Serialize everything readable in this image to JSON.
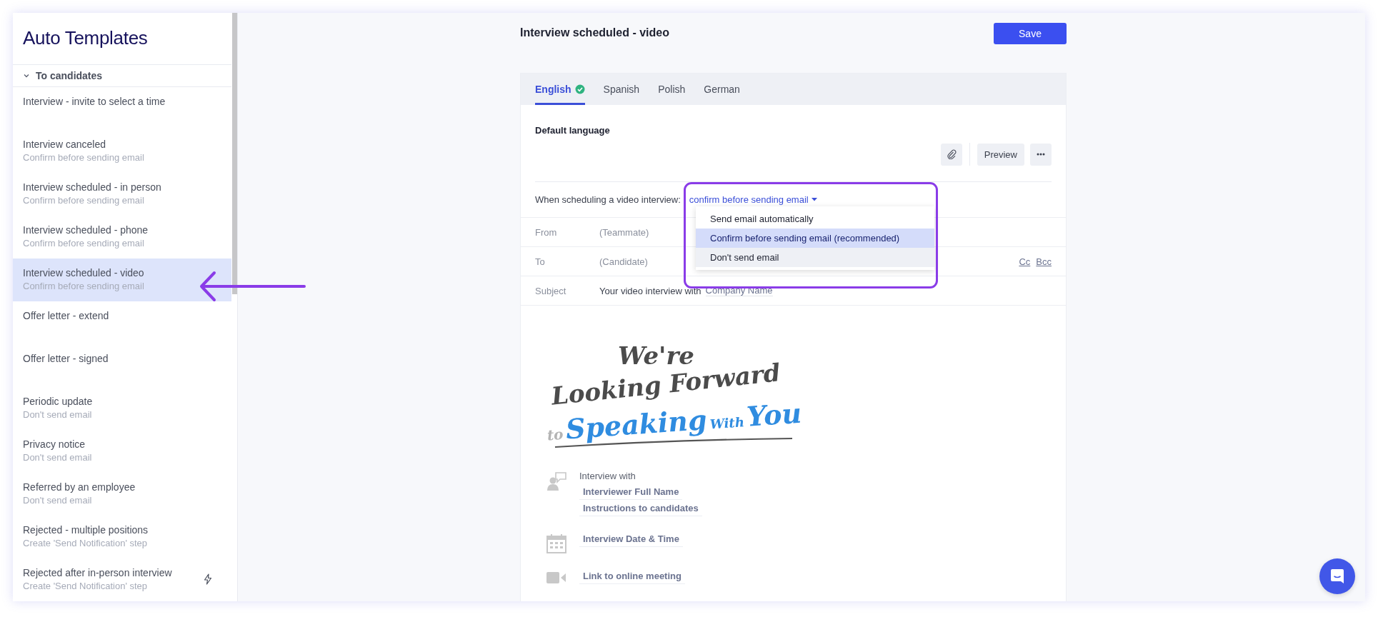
{
  "sidebar": {
    "title": "Auto Templates",
    "group": {
      "label": "To candidates",
      "expanded": true
    },
    "items": [
      {
        "title": "Interview - invite to select a time",
        "selected": false,
        "automated": false
      },
      {
        "title": "Interview canceled",
        "subtitle": "Confirm before sending email",
        "selected": false,
        "automated": false
      },
      {
        "title": "Interview scheduled - in person",
        "subtitle": "Confirm before sending email",
        "selected": false,
        "automated": false
      },
      {
        "title": "Interview scheduled - phone",
        "subtitle": "Confirm before sending email",
        "selected": false,
        "automated": false
      },
      {
        "title": "Interview scheduled - video",
        "subtitle": "Confirm before sending email",
        "selected": true,
        "automated": false
      },
      {
        "title": "Offer letter - extend",
        "selected": false,
        "automated": false
      },
      {
        "title": "Offer letter - signed",
        "selected": false,
        "automated": false
      },
      {
        "title": "Periodic update",
        "subtitle": "Don't send email",
        "selected": false,
        "automated": false
      },
      {
        "title": "Privacy notice",
        "subtitle": "Don't send email",
        "selected": false,
        "automated": false
      },
      {
        "title": "Referred by an employee",
        "subtitle": "Don't send email",
        "selected": false,
        "automated": false
      },
      {
        "title": "Rejected - multiple positions",
        "subtitle": "Create 'Send Notification' step",
        "selected": false,
        "automated": false
      },
      {
        "title": "Rejected after in-person interview",
        "subtitle": "Create 'Send Notification' step",
        "selected": false,
        "automated": true
      }
    ]
  },
  "header": {
    "title": "Interview scheduled - video",
    "save": "Save"
  },
  "tabs": [
    {
      "label": "English",
      "selected": true,
      "verified": true
    },
    {
      "label": "Spanish",
      "selected": false,
      "verified": false
    },
    {
      "label": "Polish",
      "selected": false,
      "verified": false
    },
    {
      "label": "German",
      "selected": false,
      "verified": false
    }
  ],
  "section_label": "Default language",
  "toolbar": {
    "preview": "Preview"
  },
  "rule": {
    "text": "When scheduling a video interview:",
    "value": "confirm before sending email"
  },
  "dropdown": [
    {
      "label": "Send email automatically",
      "selected": false,
      "hovered": false
    },
    {
      "label": "Confirm before sending email (recommended)",
      "selected": true,
      "hovered": false
    },
    {
      "label": "Don't send email",
      "selected": false,
      "hovered": true
    }
  ],
  "fields": [
    {
      "label": "From",
      "value": "(Teammate)"
    },
    {
      "label": "To",
      "value": "(Candidate)",
      "links": [
        "Cc",
        "Bcc"
      ]
    },
    {
      "label": "Subject",
      "value": "Your video interview with",
      "token": "Company Name"
    }
  ],
  "banner": [
    [
      {
        "text": "We're",
        "kind": "dark"
      }
    ],
    [
      {
        "text": "Looking Forward",
        "kind": "dark"
      }
    ],
    [
      {
        "text": "to",
        "kind": "faint"
      },
      {
        "text": "Speaking",
        "kind": "blue"
      },
      {
        "text": "With",
        "kind": "blue-small"
      },
      {
        "text": "You",
        "kind": "blue"
      }
    ]
  ],
  "details": [
    {
      "kind": "interviewer",
      "label": "Interview with",
      "tokens": [
        "Interviewer Full Name",
        "Instructions to candidates"
      ]
    },
    {
      "kind": "datetime",
      "tokens": [
        "Interview Date & Time"
      ]
    },
    {
      "kind": "meeting",
      "tokens": [
        "Link to online meeting"
      ]
    }
  ]
}
